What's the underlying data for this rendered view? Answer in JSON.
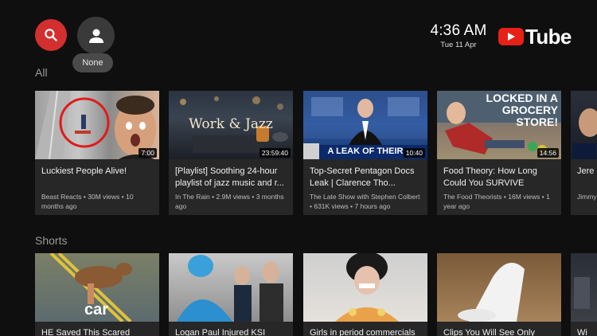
{
  "header": {
    "account_label": "None",
    "clock_time": "4:36 AM",
    "clock_date": "Tue 11 Apr",
    "logo_text": "Tube",
    "accent_color": "#d32f2f"
  },
  "sections": {
    "all": {
      "title": "All",
      "videos": [
        {
          "title": "Luckiest People Alive!",
          "meta": "Beast Reacts • 30M views • 10 months ago",
          "duration": "7:00"
        },
        {
          "title": "[Playlist] Soothing 24-hour playlist of jazz music and r...",
          "meta": "In The Rain • 2.9M views • 3 months ago",
          "duration": "23:59:40",
          "overlay": "Work & Jazz"
        },
        {
          "title": "Top-Secret Pentagon Docs Leak | Clarence Tho...",
          "meta": "The Late Show with Stephen Colbert • 631K views • 7 hours ago",
          "duration": "10:40",
          "overlay": "A LEAK OF THEIR"
        },
        {
          "title": "Food Theory: How Long Could You SURVIVE Locke...",
          "meta": "The Food Theorists • 16M views • 1 year ago",
          "duration": "14:56",
          "overlay": "LOCKED IN A GROCERY STORE!"
        },
        {
          "title": "Jere Snow",
          "meta": "Jimmy hours"
        }
      ]
    },
    "shorts": {
      "title": "Shorts",
      "videos": [
        {
          "title": "HE Saved This Scared DEER",
          "overlay": "car"
        },
        {
          "title": "Logan Paul Injured KSI"
        },
        {
          "title": "Girls in period commercials"
        },
        {
          "title": "Clips You Will See Only Once"
        },
        {
          "title": "Wi"
        }
      ]
    }
  }
}
